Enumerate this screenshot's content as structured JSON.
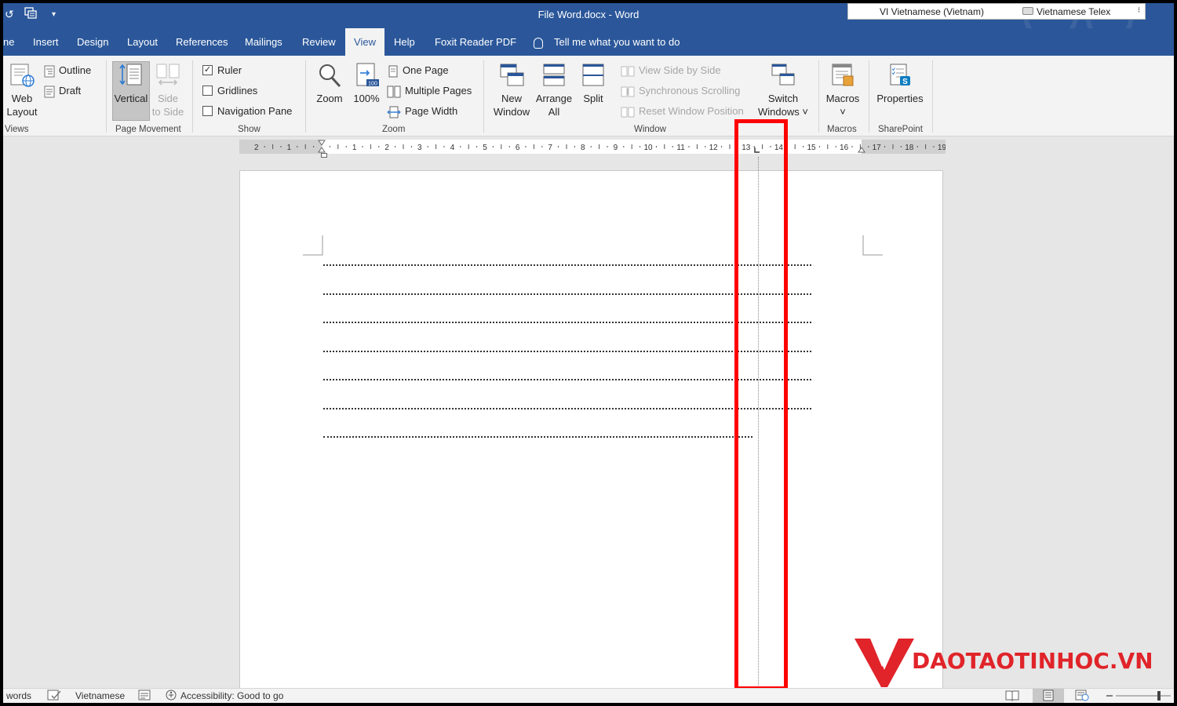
{
  "window": {
    "title": "File Word.docx  -  Word",
    "qat_undo": "↺",
    "qat_customize": "▾"
  },
  "language_bar": {
    "input_language": "VI  Vietnamese (Vietnam)",
    "keyboard": "Vietnamese Telex"
  },
  "tabs": [
    {
      "label": "ne"
    },
    {
      "label": "Insert"
    },
    {
      "label": "Design"
    },
    {
      "label": "Layout"
    },
    {
      "label": "References"
    },
    {
      "label": "Mailings"
    },
    {
      "label": "Review"
    },
    {
      "label": "View"
    },
    {
      "label": "Help"
    },
    {
      "label": "Foxit Reader PDF"
    }
  ],
  "active_tab": "View",
  "tell_me": "Tell me what you want to do",
  "ribbon": {
    "views": {
      "label": "Views",
      "web_layout_1": "Web",
      "web_layout_2": "Layout",
      "outline": "Outline",
      "draft": "Draft"
    },
    "page_movement": {
      "label": "Page Movement",
      "vertical": "Vertical",
      "side_1": "Side",
      "side_2": "to Side"
    },
    "show": {
      "label": "Show",
      "ruler": "Ruler",
      "ruler_checked": true,
      "gridlines": "Gridlines",
      "gridlines_checked": false,
      "navigation_pane": "Navigation Pane",
      "navigation_pane_checked": false,
      "check_mark": "✓"
    },
    "zoom": {
      "label": "Zoom",
      "zoom": "Zoom",
      "hundred": "100%",
      "hundred_icon_text": "100",
      "one_page": "One Page",
      "multiple_pages": "Multiple Pages",
      "page_width": "Page Width"
    },
    "window": {
      "label": "Window",
      "new_window_1": "New",
      "new_window_2": "Window",
      "arrange_all_1": "Arrange",
      "arrange_all_2": "All",
      "split": "Split",
      "view_side_by_side": "View Side by Side",
      "synchronous_scrolling": "Synchronous Scrolling",
      "reset_window_position": "Reset Window Position",
      "switch_windows_1": "Switch",
      "switch_windows_2": "Windows ˅"
    },
    "macros": {
      "label": "Macros",
      "macros": "Macros",
      "dropdown": "˅"
    },
    "sharepoint": {
      "label": "SharePoint",
      "properties": "Properties",
      "icon_letter": "S"
    }
  },
  "ruler": {
    "numbers": [
      "2",
      "1",
      "",
      "1",
      "2",
      "3",
      "4",
      "5",
      "6",
      "7",
      "8",
      "9",
      "10",
      "11",
      "12",
      "13",
      "14",
      "15",
      "16",
      "17",
      "18",
      "19"
    ]
  },
  "document": {
    "dotted_lines": 7
  },
  "watermark": {
    "text": "DAOTAOTINHOC.VN"
  },
  "status_bar": {
    "words": "words",
    "language": "Vietnamese",
    "accessibility": "Accessibility: Good to go"
  },
  "colors": {
    "word_blue": "#2b579a",
    "highlight": "#ff0000",
    "watermark_red": "#e0242a"
  }
}
